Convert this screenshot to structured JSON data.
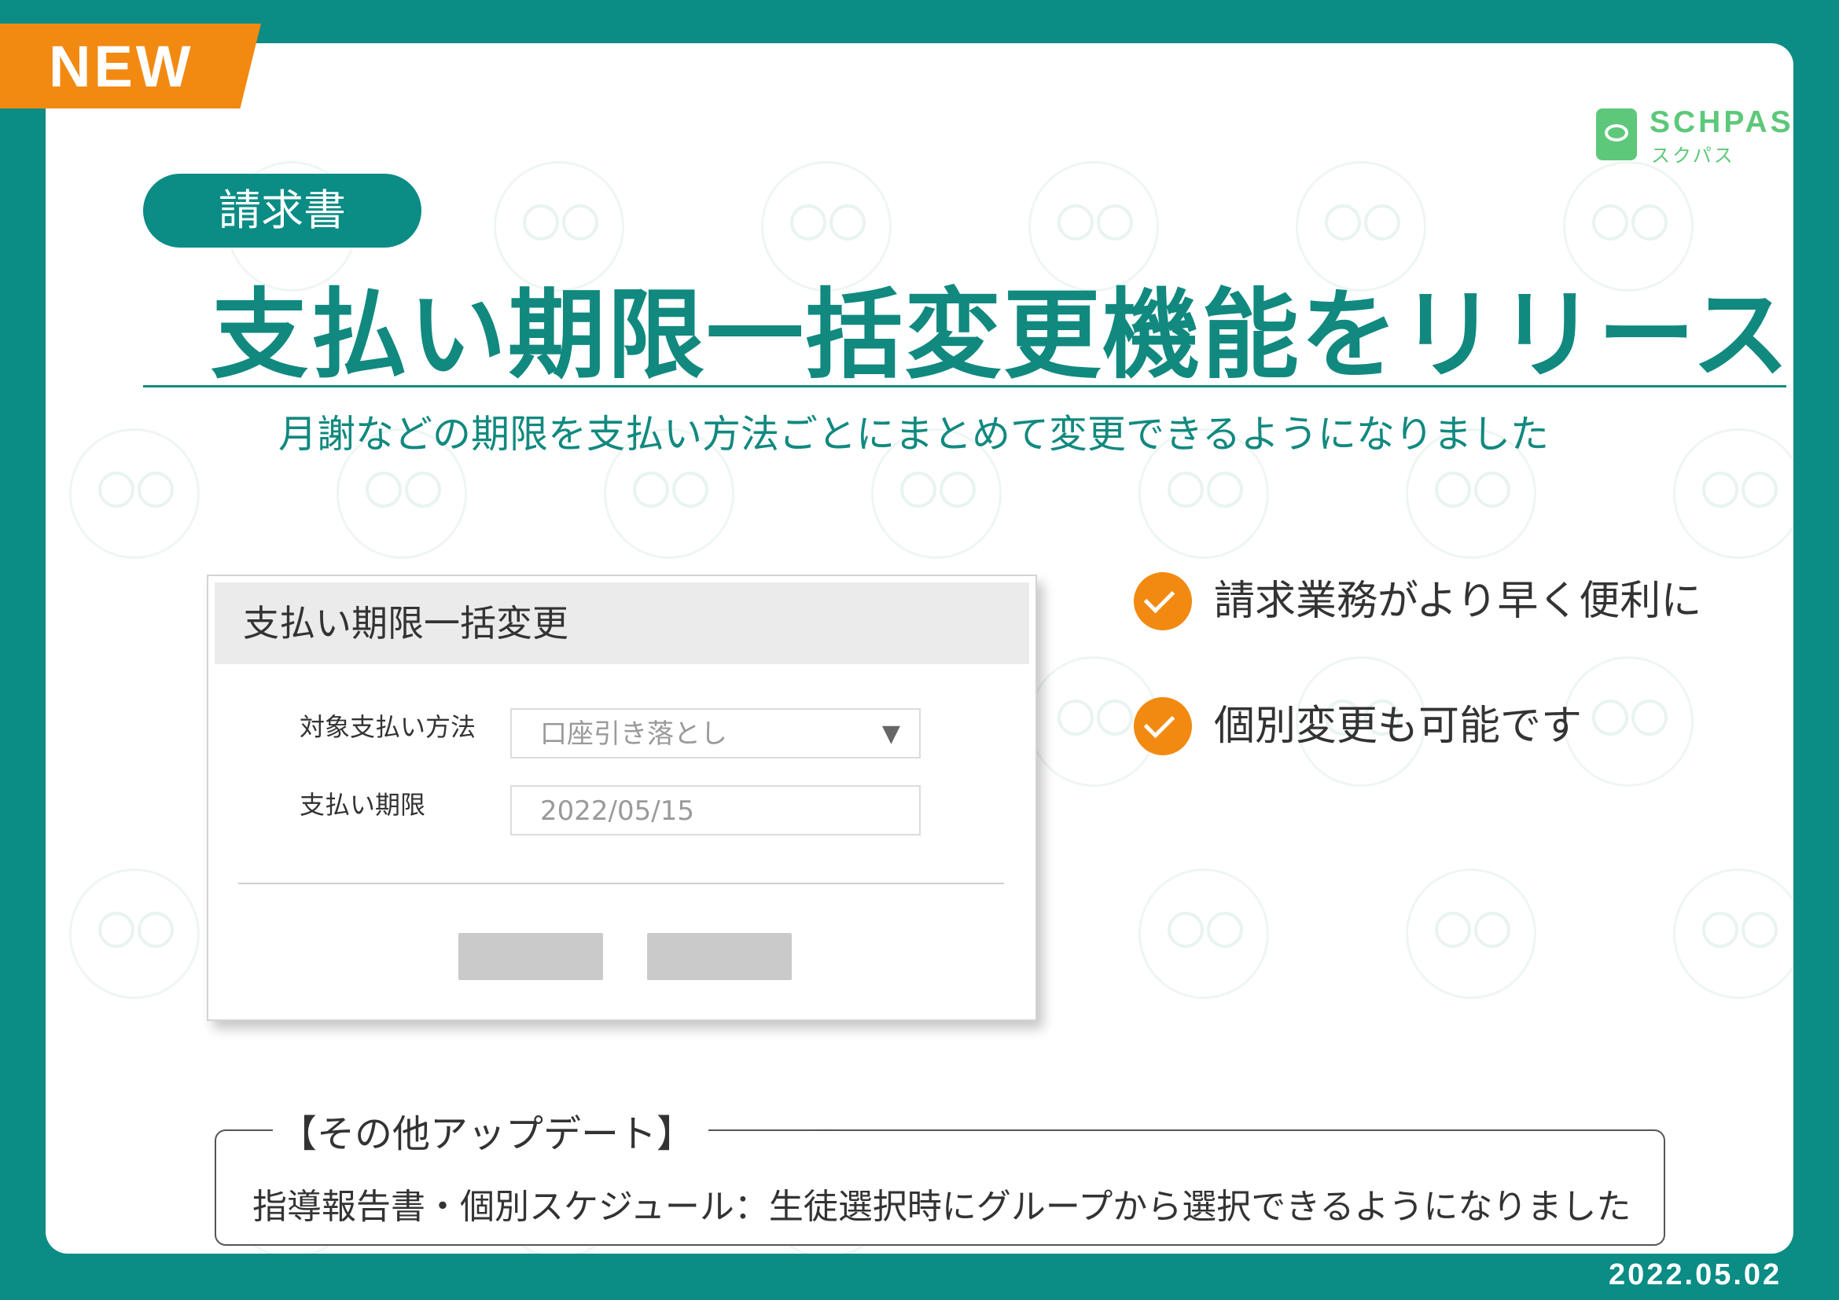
{
  "badge": {
    "new": "NEW"
  },
  "logo": {
    "name_en": "SCHPASS",
    "name_ja": "スクパス"
  },
  "category": "請求書",
  "title": "支払い期限一括変更機能をリリース",
  "subtitle": "月謝などの期限を支払い方法ごとにまとめて変更できるようになりました",
  "dialog": {
    "title": "支払い期限一括変更",
    "payment_method_label": "対象支払い方法",
    "payment_method_value": "口座引き落とし",
    "dropdown_arrow": "▼",
    "deadline_label": "支払い期限",
    "deadline_value": "2022/05/15"
  },
  "benefits": [
    {
      "text": "請求業務がより早く便利に"
    },
    {
      "text": "個別変更も可能です"
    }
  ],
  "other_updates": {
    "heading": "【その他アップデート】",
    "items": [
      "指導報告書・個別スケジュール：生徒選択時にグループから選択できるようになりました"
    ]
  },
  "date": "2022.05.02",
  "colors": {
    "teal": "#0b8c85",
    "orange": "#f28a12",
    "logo_green": "#5dc87a"
  }
}
